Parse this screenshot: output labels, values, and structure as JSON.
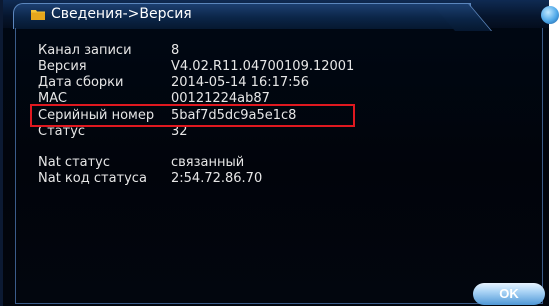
{
  "window": {
    "title": "Сведения->Версия",
    "close_icon": "close-icon",
    "title_icon": "info-folder-icon"
  },
  "info": {
    "rows": [
      {
        "label": "Канал записи",
        "value": "8"
      },
      {
        "label": "Версия",
        "value": "V4.02.R11.04700109.12001"
      },
      {
        "label": "Дата сборки",
        "value": "2014-05-14 16:17:56"
      },
      {
        "label": "MAC",
        "value": "00121224ab87"
      },
      {
        "label": "Серийный номер",
        "value": "5baf7d5dc9a5e1c8"
      },
      {
        "label": "Статус",
        "value": "32"
      },
      {
        "label": "Nat статус",
        "value": "связанный"
      },
      {
        "label": "Nat код статуса",
        "value": "2:54.72.86.70"
      }
    ]
  },
  "buttons": {
    "ok_label": "OK"
  },
  "colors": {
    "background": "#000814",
    "title_bar": "#0b2547",
    "border": "#5b86bd",
    "highlight": "#e0181f",
    "text": "#e6e6e6"
  }
}
